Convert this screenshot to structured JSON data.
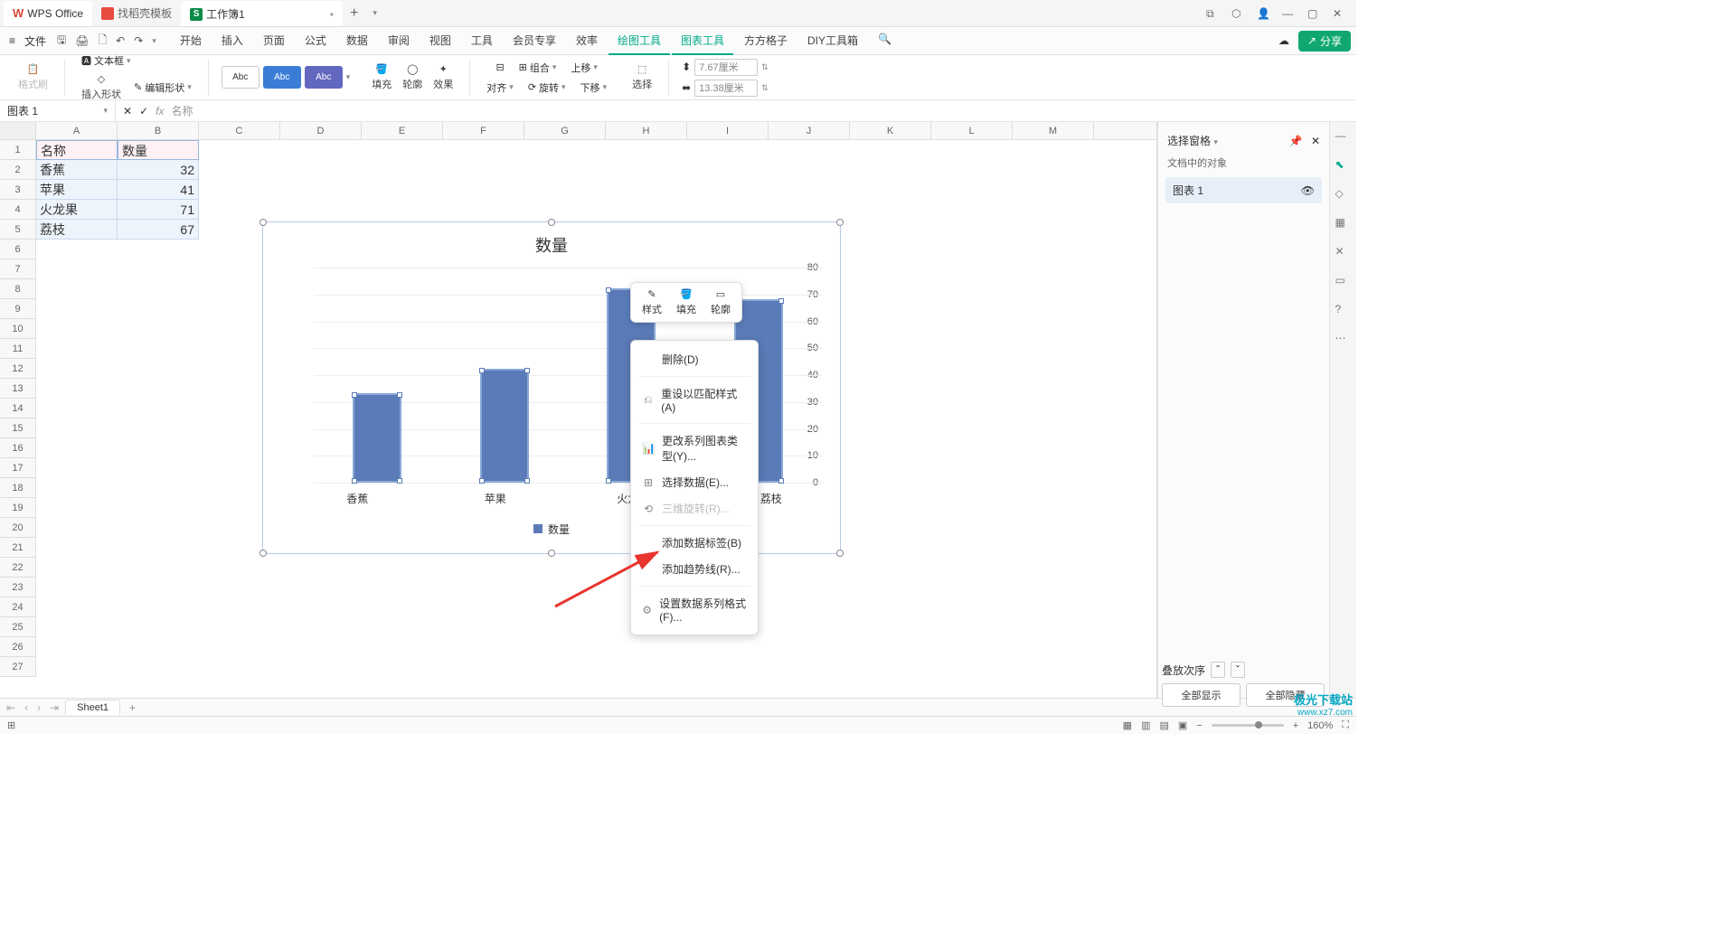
{
  "titlebar": {
    "app_name": "WPS Office",
    "template_tab": "找稻壳模板",
    "doc_tab": "工作簿1",
    "doc_badge": "S"
  },
  "menubar": {
    "file": "文件",
    "tabs": [
      "开始",
      "插入",
      "页面",
      "公式",
      "数据",
      "审阅",
      "视图",
      "工具",
      "会员专享",
      "效率",
      "绘图工具",
      "图表工具",
      "方方格子",
      "DIY工具箱"
    ],
    "share": "分享"
  },
  "ribbon": {
    "format_painter": "格式刷",
    "insert_shape": "插入形状",
    "text_box": "文本框",
    "edit_shape": "编辑形状",
    "style_label": "Abc",
    "fill": "填充",
    "outline": "轮廓",
    "effect": "效果",
    "align": "对齐",
    "group": "组合",
    "rotate": "旋转",
    "move_up": "上移",
    "move_down": "下移",
    "select": "选择",
    "width_val": "7.67厘米",
    "height_val": "13.38厘米"
  },
  "namebox": {
    "value": "图表 1",
    "fx_text": "名称"
  },
  "columns": [
    "A",
    "B",
    "C",
    "D",
    "E",
    "F",
    "G",
    "H",
    "I",
    "J",
    "K",
    "L",
    "M"
  ],
  "sheet_data": {
    "header": [
      "名称",
      "数量"
    ],
    "rows": [
      [
        "香蕉",
        "32"
      ],
      [
        "苹果",
        "41"
      ],
      [
        "火龙果",
        "71"
      ],
      [
        "荔枝",
        "67"
      ]
    ]
  },
  "chart_data": {
    "type": "bar",
    "title": "数量",
    "categories": [
      "香蕉",
      "苹果",
      "火龙果",
      "荔枝"
    ],
    "values": [
      32,
      41,
      71,
      67
    ],
    "ylim": [
      0,
      80
    ],
    "yticks": [
      0,
      10,
      20,
      30,
      40,
      50,
      60,
      70,
      80
    ],
    "legend": "数量"
  },
  "mini_toolbar": {
    "style": "样式",
    "fill": "填充",
    "outline": "轮廓"
  },
  "context_menu": {
    "delete": "删除(D)",
    "reset": "重设以匹配样式(A)",
    "change_type": "更改系列图表类型(Y)...",
    "select_data": "选择数据(E)...",
    "rotate_3d": "三维旋转(R)...",
    "add_labels": "添加数据标签(B)",
    "add_trend": "添加趋势线(R)...",
    "format_series": "设置数据系列格式(F)..."
  },
  "selection_pane": {
    "title": "选择窗格",
    "subtitle": "文档中的对象",
    "item": "图表 1",
    "order": "叠放次序",
    "show_all": "全部显示",
    "hide_all": "全部隐藏"
  },
  "sheet_tabs": {
    "sheet1": "Sheet1"
  },
  "statusbar": {
    "zoom": "160%"
  },
  "watermark": {
    "line1": "极光下载站",
    "line2": "www.xz7.com"
  }
}
